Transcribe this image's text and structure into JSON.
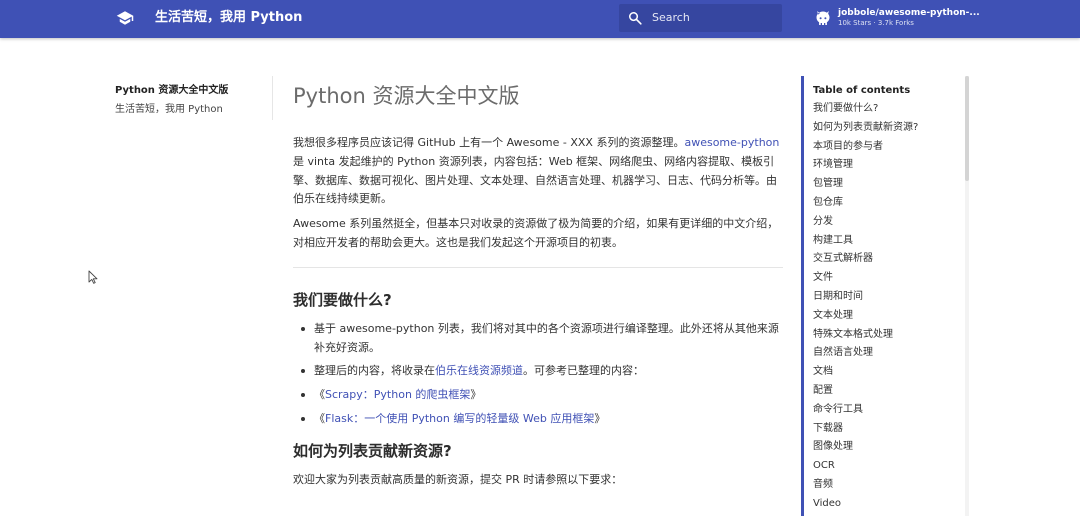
{
  "header": {
    "site_title": "生活苦短，我用 Python",
    "logo_icon": "graduation-cap-icon",
    "search": {
      "placeholder": "Search",
      "icon": "search-icon"
    },
    "repo": {
      "icon": "github-icon",
      "name": "jobbole/awesome-python-...",
      "stats": "10k Stars · 3.7k Forks"
    },
    "accent_color": "#3f51b5"
  },
  "left_nav": {
    "title": "Python 资源大全中文版",
    "subtitle": "生活苦短，我用 Python"
  },
  "article": {
    "title": "Python 资源大全中文版",
    "intro": {
      "p1_before": "我想很多程序员应该记得 GitHub 上有一个 Awesome - XXX 系列的资源整理。",
      "p1_link": "awesome-python",
      "p1_after": " 是 vinta 发起维护的 Python 资源列表，内容包括：Web 框架、网络爬虫、网络内容提取、模板引擎、数据库、数据可视化、图片处理、文本处理、自然语言处理、机器学习、日志、代码分析等。由伯乐在线持续更新。",
      "p2": "Awesome 系列虽然挺全，但基本只对收录的资源做了极为简要的介绍，如果有更详细的中文介绍，对相应开发者的帮助会更大。这也是我们发起这个开源项目的初衷。"
    },
    "section1": {
      "title": "我们要做什么?",
      "items": {
        "i1": "基于 awesome-python 列表，我们将对其中的各个资源项进行编译整理。此外还将从其他来源补充好资源。",
        "i2_before": "整理后的内容，将收录在",
        "i2_link": "伯乐在线资源频道",
        "i2_after": "。可参考已整理的内容：",
        "i3_open": "《",
        "i3_link": "Scrapy：Python 的爬虫框架",
        "i3_close": "》",
        "i4_open": "《",
        "i4_link": "Flask：一个使用 Python 编写的轻量级 Web 应用框架",
        "i4_close": "》"
      }
    },
    "section2": {
      "title": "如何为列表贡献新资源?",
      "p": "欢迎大家为列表贡献高质量的新资源，提交 PR 时请参照以下要求："
    }
  },
  "toc": {
    "title": "Table of contents",
    "items": [
      "我们要做什么?",
      "如何为列表贡献新资源?",
      "本项目的参与者",
      "环境管理",
      "包管理",
      "包仓库",
      "分发",
      "构建工具",
      "交互式解析器",
      "文件",
      "日期和时间",
      "文本处理",
      "特殊文本格式处理",
      "自然语言处理",
      "文档",
      "配置",
      "命令行工具",
      "下载器",
      "图像处理",
      "OCR",
      "音频",
      "Video"
    ]
  }
}
